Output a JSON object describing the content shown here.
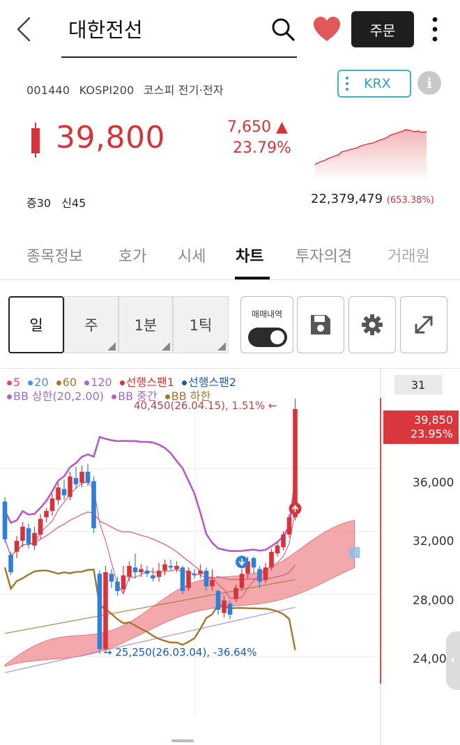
{
  "header": {
    "title": "대한전선",
    "order_label": "주문"
  },
  "stock": {
    "code": "001440",
    "index": "KOSPI200",
    "market_sector": "코스피 전기·전자",
    "exchange": "KRX",
    "info_label": "i",
    "price": "39,800",
    "change": "7,650 ▲",
    "change_pct": "23.79%",
    "margin": "증30",
    "credit": "신45",
    "volume": "22,379,479",
    "volume_pct": "(653.38%)",
    "up_color": "#d6343a"
  },
  "tabs": [
    "종목정보",
    "호가",
    "시세",
    "차트",
    "투자의견",
    "거래원"
  ],
  "active_tab": "차트",
  "periods": [
    "일",
    "주",
    "1분",
    "1틱"
  ],
  "active_period": "일",
  "tools": {
    "trade_history_label": "매매내역",
    "save": "save-icon",
    "settings": "gear-icon",
    "expand": "expand-icon"
  },
  "chart_data": {
    "type": "candlestick",
    "legend": [
      {
        "name": "5",
        "color": "#e0457b"
      },
      {
        "name": "20",
        "color": "#4a90d9"
      },
      {
        "name": "60",
        "color": "#a8742a"
      },
      {
        "name": "120",
        "color": "#a46ac8"
      },
      {
        "name": "선행스팬1",
        "color": "#d6343a"
      },
      {
        "name": "선행스팬2",
        "color": "#1f5aa6"
      },
      {
        "name": "BB 상한(20,2.00)",
        "color": "#a46ac8"
      },
      {
        "name": "BB 중간",
        "color": "#a46ac8"
      },
      {
        "name": "BB 하한",
        "color": "#a8742a"
      }
    ],
    "annotations": {
      "high": "40,450(26.04.15), 1.51% ←",
      "low": "→ 25,250(26.03.04), -36.64%"
    },
    "last_label": "31",
    "current_price": "39,850",
    "current_pct": "23.95%",
    "y_ticks": [
      "36,000",
      "32,000",
      "28,000",
      "24,00"
    ],
    "y_tick_values": [
      36000,
      32000,
      28000,
      24000
    ],
    "ylim": [
      21500,
      40500
    ],
    "candles": [
      [
        33900,
        31500,
        34200,
        31300
      ],
      [
        30500,
        29400,
        30700,
        29200
      ],
      [
        30700,
        31400,
        31700,
        30300
      ],
      [
        31400,
        32300,
        32600,
        31000
      ],
      [
        32200,
        31200,
        32500,
        30900
      ],
      [
        31100,
        31900,
        32300,
        30800
      ],
      [
        31800,
        32800,
        33100,
        31500
      ],
      [
        32900,
        33300,
        33500,
        32600
      ],
      [
        33300,
        34100,
        34400,
        33000
      ],
      [
        34000,
        34800,
        35100,
        33700
      ],
      [
        34700,
        34300,
        35300,
        34000
      ],
      [
        34200,
        35500,
        35800,
        34000
      ],
      [
        35400,
        35000,
        36100,
        34700
      ],
      [
        35100,
        35800,
        36200,
        34800
      ],
      [
        35800,
        35100,
        36300,
        34900
      ],
      [
        35200,
        32200,
        35500,
        31900
      ],
      [
        29300,
        24500,
        29500,
        24200
      ],
      [
        24500,
        29400,
        29800,
        24300
      ],
      [
        29300,
        28800,
        29600,
        28400
      ],
      [
        28800,
        28200,
        29100,
        27900
      ],
      [
        28300,
        29200,
        29800,
        28100
      ],
      [
        29100,
        29800,
        30100,
        28800
      ],
      [
        29700,
        29400,
        30600,
        29000
      ],
      [
        29400,
        29600,
        29900,
        29100
      ],
      [
        29500,
        29300,
        29800,
        29100
      ],
      [
        29200,
        29000,
        29700,
        28800
      ],
      [
        29100,
        29500,
        30000,
        28800
      ],
      [
        29500,
        29900,
        30200,
        29200
      ],
      [
        29800,
        29700,
        30200,
        29500
      ],
      [
        29600,
        29800,
        30100,
        29400
      ],
      [
        29700,
        28200,
        29800,
        28000
      ],
      [
        28400,
        29500,
        29700,
        28200
      ],
      [
        29300,
        29200,
        29600,
        29000
      ],
      [
        29300,
        29500,
        29900,
        29000
      ],
      [
        29500,
        28500,
        29700,
        28200
      ],
      [
        28500,
        28900,
        29600,
        28200
      ],
      [
        28200,
        27000,
        28300,
        26700
      ],
      [
        26800,
        27600,
        27900,
        26500
      ],
      [
        27400,
        26700,
        27600,
        26400
      ],
      [
        27700,
        28400,
        28600,
        27500
      ],
      [
        28400,
        29300,
        29600,
        28200
      ],
      [
        29300,
        30100,
        30400,
        29000
      ],
      [
        30300,
        29700,
        30400,
        29300
      ],
      [
        29600,
        28800,
        29800,
        28400
      ],
      [
        28900,
        29700,
        30000,
        28700
      ],
      [
        29700,
        30700,
        30900,
        29500
      ],
      [
        30600,
        31100,
        31300,
        30400
      ],
      [
        31000,
        31800,
        32000,
        30800
      ],
      [
        31800,
        32900,
        33100,
        31600
      ],
      [
        32900,
        39800,
        40450,
        32700
      ]
    ]
  }
}
